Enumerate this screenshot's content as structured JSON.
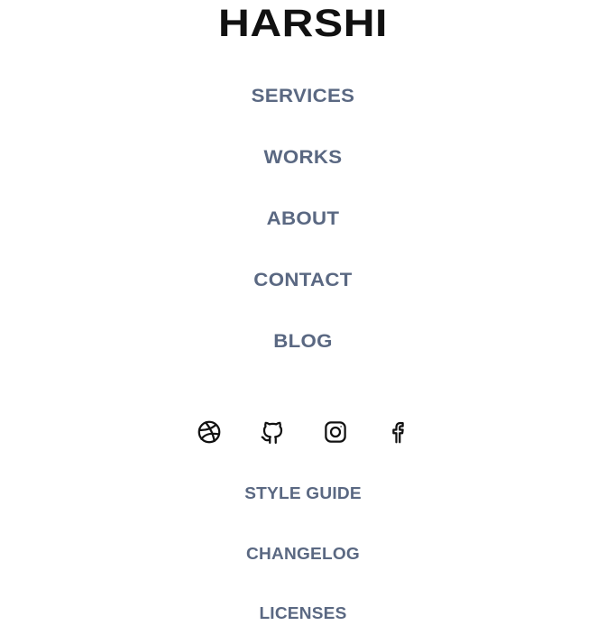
{
  "brand": {
    "name": "HARSHI"
  },
  "nav": {
    "items": [
      {
        "label": "SERVICES"
      },
      {
        "label": "WORKS"
      },
      {
        "label": "ABOUT"
      },
      {
        "label": "CONTACT"
      },
      {
        "label": "BLOG"
      }
    ]
  },
  "social": {
    "icons": [
      "dribbble-icon",
      "github-icon",
      "instagram-icon",
      "facebook-icon"
    ]
  },
  "footer": {
    "links": [
      {
        "label": "STYLE GUIDE"
      },
      {
        "label": "CHANGELOG"
      },
      {
        "label": "LICENSES"
      }
    ]
  },
  "colors": {
    "brand_text": "#111111",
    "link_text": "#5a6882",
    "icon_stroke": "#111111",
    "background": "#ffffff"
  }
}
